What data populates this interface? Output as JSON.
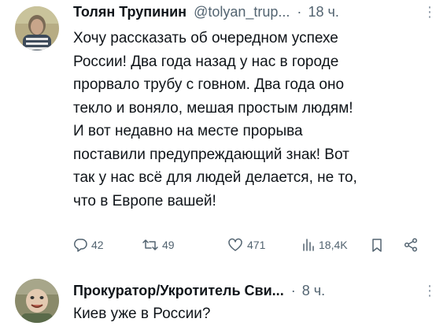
{
  "tweet": {
    "author_name": "Толян Трупинин",
    "author_handle": "@tolyan_trup...",
    "separator": "·",
    "time": "18 ч.",
    "more": "⋮",
    "text_lines": [
      "Хочу рассказать об очередном успехе",
      "России! Два года назад у нас в городе",
      "прорвало трубу с говном. Два года оно",
      "текло и воняло, мешая простым людям!",
      "И вот недавно на месте прорыва",
      "поставили предупреждающий знак! Вот",
      "так у нас всё для людей делается, не то,",
      "что в Европе вашей!"
    ],
    "actions": {
      "replies": "42",
      "retweets": "49",
      "likes": "471",
      "views": "18,4K"
    }
  },
  "reply": {
    "author_name": "Прокуратор/Укротитель Сви...",
    "separator": "·",
    "time": "8 ч.",
    "more": "⋮",
    "text": "Киев уже в России?"
  },
  "colors": {
    "text": "#0f1419",
    "secondary": "#536471",
    "background": "#ffffff"
  },
  "icons": [
    "reply-icon",
    "retweet-icon",
    "like-icon",
    "views-icon",
    "bookmark-icon",
    "share-icon",
    "more-icon"
  ]
}
